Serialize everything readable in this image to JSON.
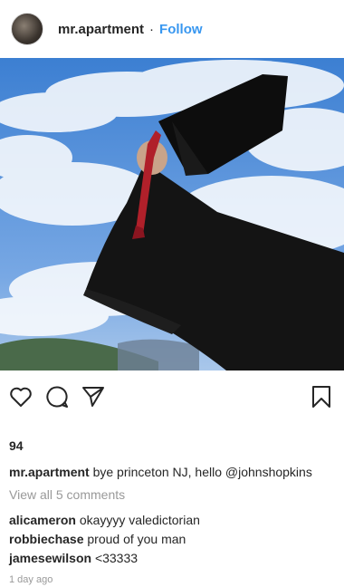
{
  "post": {
    "username": "mr.apartment",
    "separator": "·",
    "follow_label": "Follow",
    "likes": "94",
    "caption_user": "mr.apartment",
    "caption_text": "bye princeton NJ, hello @johnshopkins",
    "view_all_comments": "View all 5 comments",
    "comments": [
      {
        "user": "alicameron",
        "text": "okayyyy valedictorian"
      },
      {
        "user": "robbiechase",
        "text": "proud of you man"
      },
      {
        "user": "jamesewilson",
        "text": "<33333"
      }
    ],
    "timestamp": "1 day ago"
  },
  "icons": {
    "like": "heart-icon",
    "comment": "comment-icon",
    "share": "share-icon",
    "save": "bookmark-icon"
  },
  "colors": {
    "follow": "#3897f0",
    "muted": "#999999",
    "text": "#262626",
    "sky": "#4a88d6",
    "gown": "#141414",
    "tassel": "#b0202a"
  }
}
